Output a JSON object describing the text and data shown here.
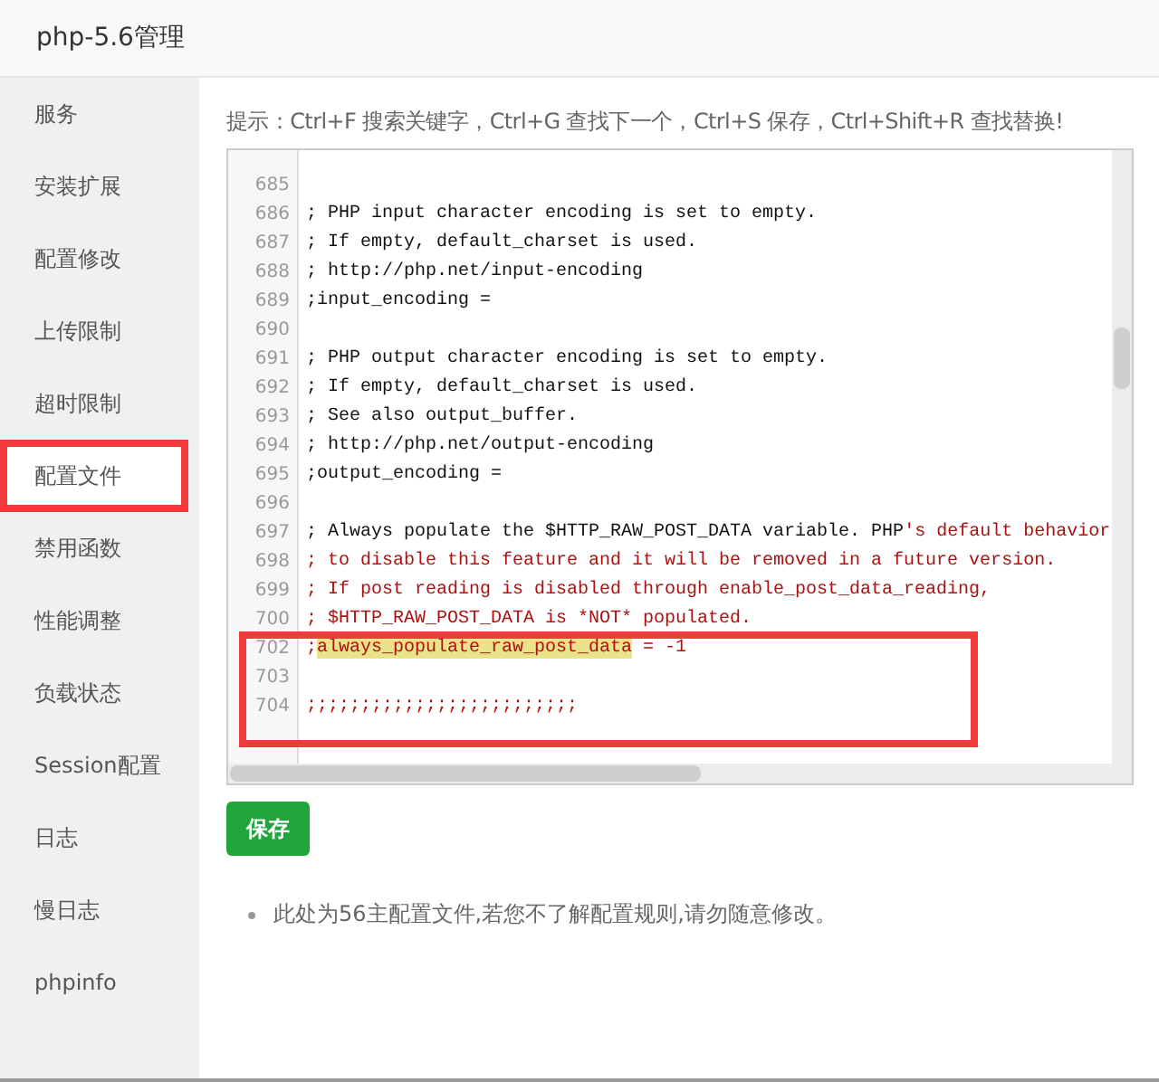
{
  "window": {
    "title": "php-5.6管理"
  },
  "sidebar": {
    "items": [
      {
        "label": "服务",
        "selected": false
      },
      {
        "label": "安装扩展",
        "selected": false
      },
      {
        "label": "配置修改",
        "selected": false
      },
      {
        "label": "上传限制",
        "selected": false
      },
      {
        "label": "超时限制",
        "selected": false
      },
      {
        "label": "配置文件",
        "selected": true
      },
      {
        "label": "禁用函数",
        "selected": false
      },
      {
        "label": "性能调整",
        "selected": false
      },
      {
        "label": "负载状态",
        "selected": false
      },
      {
        "label": "Session配置",
        "selected": false
      },
      {
        "label": "日志",
        "selected": false
      },
      {
        "label": "慢日志",
        "selected": false
      },
      {
        "label": "phpinfo",
        "selected": false
      }
    ]
  },
  "hint": "提示：Ctrl+F 搜索关键字，Ctrl+G 查找下一个，Ctrl+S 保存，Ctrl+Shift+R 查找替换!",
  "editor": {
    "lines": [
      {
        "number": "685"
      },
      {
        "number": "686",
        "parts": [
          {
            "text": "; PHP input character encoding is set to empty.",
            "kind": "plain"
          }
        ]
      },
      {
        "number": "687",
        "parts": [
          {
            "text": "; If empty, default_charset is used.",
            "kind": "plain"
          }
        ]
      },
      {
        "number": "688",
        "parts": [
          {
            "text": "; http://php.net/input-encoding",
            "kind": "plain"
          }
        ]
      },
      {
        "number": "689",
        "parts": [
          {
            "text": ";input_encoding =",
            "kind": "plain"
          }
        ]
      },
      {
        "number": "690"
      },
      {
        "number": "691",
        "parts": [
          {
            "text": "; PHP output character encoding is set to empty.",
            "kind": "plain"
          }
        ]
      },
      {
        "number": "692",
        "parts": [
          {
            "text": "; If empty, default_charset is used.",
            "kind": "plain"
          }
        ]
      },
      {
        "number": "693",
        "parts": [
          {
            "text": "; See also output_buffer.",
            "kind": "plain"
          }
        ]
      },
      {
        "number": "694",
        "parts": [
          {
            "text": "; http://php.net/output-encoding",
            "kind": "plain"
          }
        ]
      },
      {
        "number": "695",
        "parts": [
          {
            "text": ";output_encoding =",
            "kind": "plain"
          }
        ]
      },
      {
        "number": "696"
      },
      {
        "number": "697",
        "parts": [
          {
            "text": "; Always populate the $HTTP_RAW_POST_DATA variable. PHP",
            "kind": "plain"
          },
          {
            "text": "'s default behavior",
            "kind": "string"
          }
        ]
      },
      {
        "number": "698",
        "parts": [
          {
            "text": "; to disable this feature and it will be removed in a future version.",
            "kind": "string"
          }
        ]
      },
      {
        "number": "699",
        "parts": [
          {
            "text": "; If post reading is disabled through enable_post_data_reading,",
            "kind": "string"
          }
        ]
      },
      {
        "number": "700",
        "parts": [
          {
            "text": "; $HTTP_RAW_POST_DATA is *NOT* populated.",
            "kind": "string"
          }
        ]
      },
      {
        "number": "702",
        "parts": [
          {
            "text": ";",
            "kind": "string"
          },
          {
            "text": "always_populate_raw_post_data",
            "kind": "match"
          },
          {
            "text": " = -1",
            "kind": "string"
          }
        ]
      },
      {
        "number": "703"
      },
      {
        "number": "704",
        "parts": [
          {
            "text": ";;;;;;;;;;;;;;;;;;;;;;;;;",
            "kind": "string"
          }
        ]
      }
    ]
  },
  "save_button": "保存",
  "notes": [
    "此处为56主配置文件,若您不了解配置规则,请勿随意修改。"
  ]
}
